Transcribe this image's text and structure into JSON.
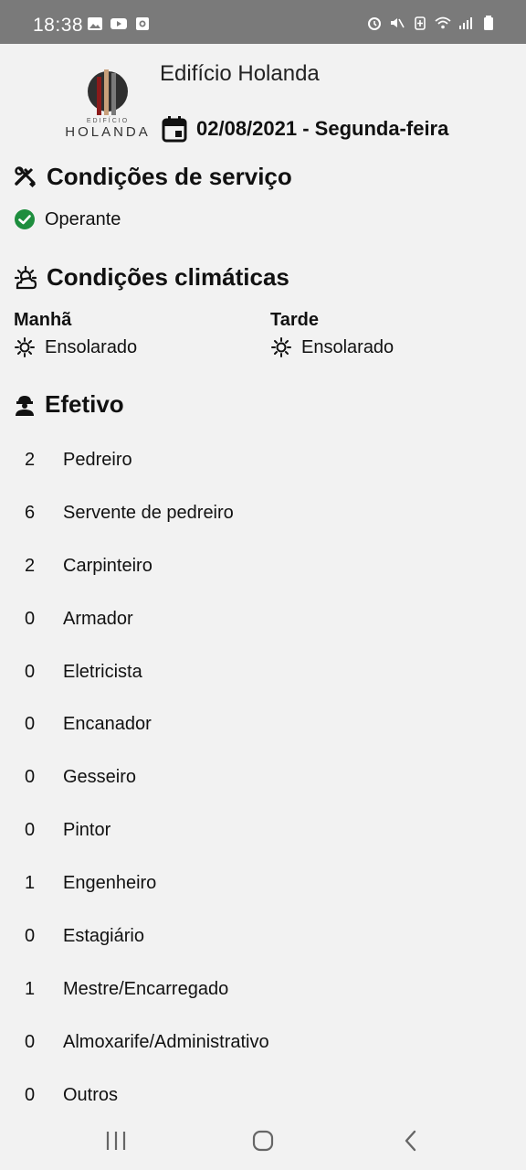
{
  "status_bar": {
    "time": "18:38",
    "left_icons": [
      "gallery-icon",
      "youtube-icon",
      "record-icon"
    ],
    "right_icons": [
      "alarm-icon",
      "mute-icon",
      "battery-saver-icon",
      "wifi-icon",
      "signal-icon",
      "battery-icon"
    ]
  },
  "header": {
    "logo_top_text": "EDIFÍCIO",
    "logo_bottom_text": "HOLANDA",
    "project_name": "Edifício Holanda",
    "date": "02/08/2021 - Segunda-feira"
  },
  "service": {
    "title": "Condições de serviço",
    "status": "Operante",
    "status_color": "#1e8e3e"
  },
  "weather": {
    "title": "Condições climáticas",
    "morning_label": "Manhã",
    "morning_value": "Ensolarado",
    "afternoon_label": "Tarde",
    "afternoon_value": "Ensolarado"
  },
  "staff": {
    "title": "Efetivo",
    "rows": [
      {
        "count": "2",
        "role": "Pedreiro"
      },
      {
        "count": "6",
        "role": "Servente de pedreiro"
      },
      {
        "count": "2",
        "role": "Carpinteiro"
      },
      {
        "count": "0",
        "role": "Armador"
      },
      {
        "count": "0",
        "role": "Eletricista"
      },
      {
        "count": "0",
        "role": "Encanador"
      },
      {
        "count": "0",
        "role": "Gesseiro"
      },
      {
        "count": "0",
        "role": "Pintor"
      },
      {
        "count": "1",
        "role": "Engenheiro"
      },
      {
        "count": "0",
        "role": "Estagiário"
      },
      {
        "count": "1",
        "role": "Mestre/Encarregado"
      },
      {
        "count": "0",
        "role": "Almoxarife/Administrativo"
      },
      {
        "count": "0",
        "role": "Outros"
      }
    ]
  }
}
